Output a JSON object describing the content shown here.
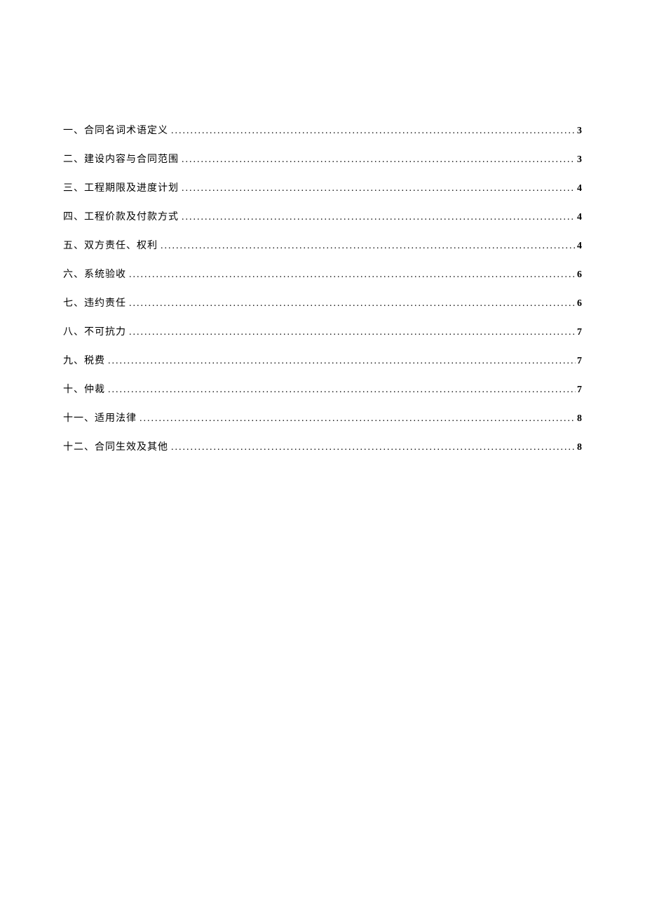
{
  "toc": {
    "entries": [
      {
        "label": "一、合同名词术语定义",
        "page": "3"
      },
      {
        "label": "二、建设内容与合同范围",
        "page": "3"
      },
      {
        "label": "三、工程期限及进度计划",
        "page": "4"
      },
      {
        "label": "四、工程价款及付款方式",
        "page": "4"
      },
      {
        "label": "五、双方责任、权利",
        "page": "4"
      },
      {
        "label": "六、系统验收",
        "page": "6"
      },
      {
        "label": "七、违约责任",
        "page": "6"
      },
      {
        "label": "八、不可抗力",
        "page": "7"
      },
      {
        "label": "九、税费",
        "page": "7"
      },
      {
        "label": "十、仲裁",
        "page": "7"
      },
      {
        "label": "十一、适用法律",
        "page": "8"
      },
      {
        "label": "十二、合同生效及其他",
        "page": "8"
      }
    ]
  }
}
